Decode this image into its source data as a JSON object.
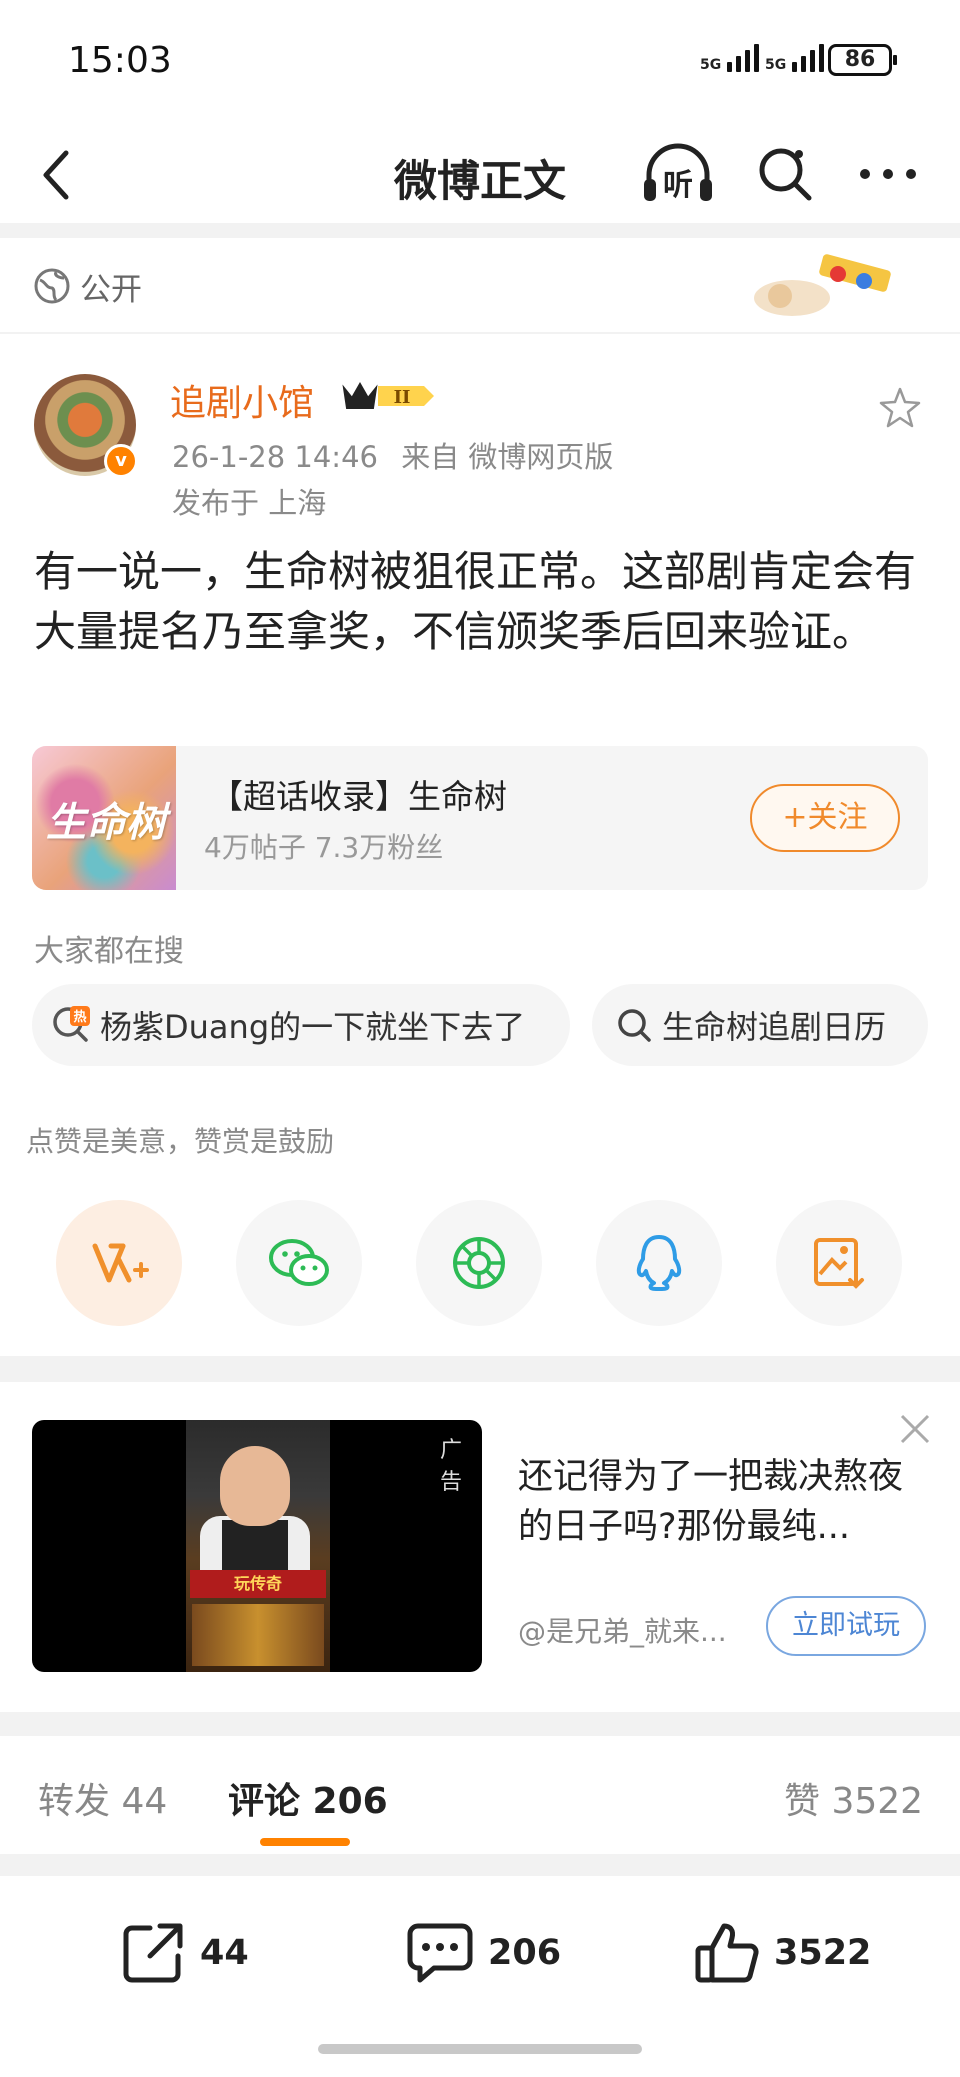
{
  "status_bar": {
    "time": "15:03",
    "battery": "86",
    "network": [
      "5G",
      "5G"
    ]
  },
  "nav": {
    "title": "微博正文",
    "listen_label": "听"
  },
  "visibility": {
    "label": "公开"
  },
  "post": {
    "username": "追剧小馆",
    "level_badge": "II",
    "timestamp": "26-1-28 14:46",
    "source": "来自 微博网页版",
    "location": "发布于 上海",
    "text": "有一说一，生命树被狙很正常。这部剧肯定会有大量提名乃至拿奖，不信颁奖季后回来验证。",
    "topic": {
      "image_text": "生命树",
      "title": "【超话收录】生命树",
      "stats": "4万帖子 7.3万粉丝",
      "follow_label": "+关注"
    },
    "search_heading": "大家都在搜",
    "search_chips": [
      {
        "badge": "热",
        "text": "杨紫Duang的一下就坐下去了"
      },
      {
        "text": "生命树追剧日历"
      }
    ],
    "reward_hint": "点赞是美意，赞赏是鼓励",
    "share_targets": [
      "reward-icon",
      "wechat-icon",
      "moments-icon",
      "qq-icon",
      "save-image-icon"
    ]
  },
  "ad": {
    "tag": "广告",
    "title": "还记得为了一把裁决熬夜的日子吗?那份最纯...",
    "source": "@是兄弟_就来...",
    "cta": "立即试玩",
    "media_banner": "玩传奇"
  },
  "tabs": [
    {
      "label": "转发 44"
    },
    {
      "label": "评论 206",
      "active": true
    },
    {
      "label": "赞 3522"
    }
  ],
  "bottom_actions": [
    {
      "icon": "share-icon",
      "count": "44"
    },
    {
      "icon": "comment-icon",
      "count": "206"
    },
    {
      "icon": "like-icon",
      "count": "3522"
    }
  ],
  "colors": {
    "accent": "#ff8200",
    "username": "#e86b1c",
    "link_blue": "#4d86d4"
  }
}
